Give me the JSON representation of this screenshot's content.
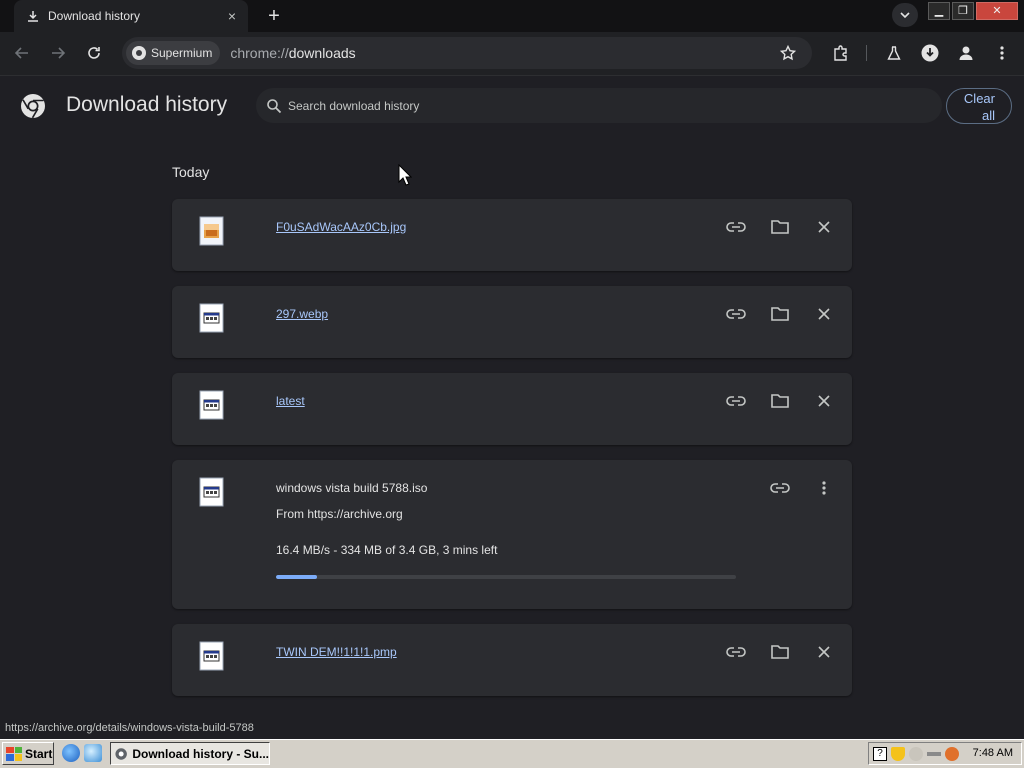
{
  "browser": {
    "tab_title": "Download history",
    "new_tab_label": "+",
    "tab_close": "×",
    "profile_chip": "Supermium",
    "url_scheme": "chrome://",
    "url_host": "downloads"
  },
  "page": {
    "title": "Download history",
    "search_placeholder": "Search download history",
    "clear_all_line1": "Clear",
    "clear_all_line2": "all",
    "section_today": "Today"
  },
  "downloads": [
    {
      "name": "F0uSAdWacAAz0Cb.jpg",
      "icon": "jpg-file-icon"
    },
    {
      "name": "297.webp",
      "icon": "generic-file-icon"
    },
    {
      "name": "latest",
      "icon": "generic-file-icon"
    },
    {
      "name": "windows vista build 5788.iso",
      "from": "From https://archive.org",
      "progress_text": "16.4 MB/s - 334 MB of 3.4 GB, 3 mins left",
      "progress": 0.09,
      "icon": "generic-file-icon"
    },
    {
      "name": "TWIN DEM!!1!1!1.pmp",
      "icon": "generic-file-icon"
    }
  ],
  "status_url": "https://archive.org/details/windows-vista-build-5788",
  "taskbar": {
    "start_label": "Start",
    "task_label": "Download history - Su...",
    "clock": "7:48 AM"
  },
  "colors": {
    "accent": "#a8c7fa",
    "progress": "#7cacf8",
    "card_bg": "#2b2c30",
    "page_bg": "#1f1f24"
  }
}
